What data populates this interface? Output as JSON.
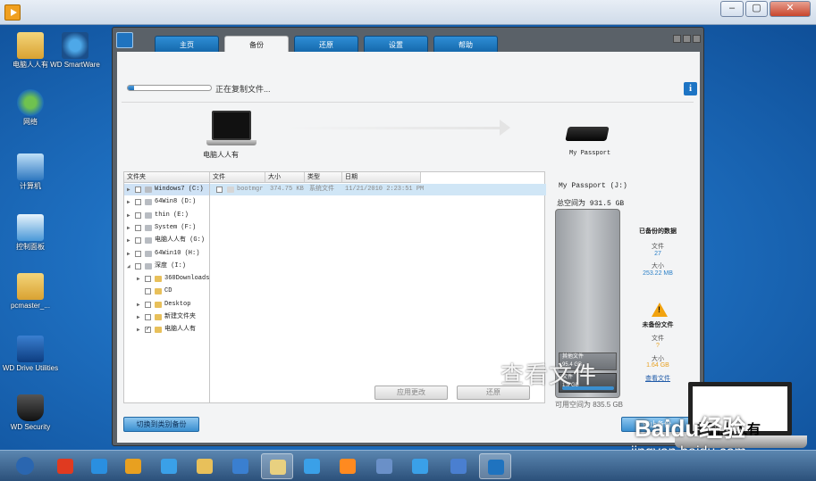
{
  "window": {
    "minimize": "–",
    "maximize": "▢",
    "close": "✕"
  },
  "desktop_icons": [
    {
      "label": "电脑人人有",
      "icon": "folder-icon"
    },
    {
      "label": "WD SmartWare",
      "icon": "wd-smartware-icon"
    },
    {
      "label": "网络",
      "icon": "network-icon"
    },
    {
      "label": "计算机",
      "icon": "computer-icon"
    },
    {
      "label": "控制面板",
      "icon": "control-panel-icon"
    },
    {
      "label": "pcmaster_...",
      "icon": "folder-icon"
    },
    {
      "label": "WD Drive Utilities",
      "icon": "wd-drive-utilities-icon"
    },
    {
      "label": "WD Security",
      "icon": "wd-security-icon"
    }
  ],
  "app": {
    "tabs": [
      "主页",
      "备份",
      "还原",
      "设置",
      "帮助"
    ],
    "active_tab": "备份",
    "copy_progress": 0.08,
    "copy_status": "正在复制文件...",
    "source_label": "电脑人人有",
    "dest_label": "My Passport",
    "folder_header": "文件夹",
    "file_headers": [
      "文件",
      "大小",
      "类型",
      "日期"
    ],
    "folders": [
      {
        "label": "Windows7 (C:)",
        "checked": false,
        "expandable": true,
        "level": 0,
        "selected": true
      },
      {
        "label": "64Win8 (D:)",
        "checked": false,
        "expandable": true,
        "level": 0
      },
      {
        "label": "thin (E:)",
        "checked": false,
        "expandable": true,
        "level": 0
      },
      {
        "label": "System (F:)",
        "checked": false,
        "expandable": true,
        "level": 0
      },
      {
        "label": "电脑人人有 (G:)",
        "checked": false,
        "expandable": true,
        "level": 0
      },
      {
        "label": "64Win10 (H:)",
        "checked": false,
        "expandable": true,
        "level": 0
      },
      {
        "label": "深度 (I:)",
        "checked": false,
        "expandable": true,
        "level": 0,
        "expanded": true
      },
      {
        "label": "360Downloads",
        "checked": false,
        "expandable": true,
        "level": 1
      },
      {
        "label": "CD",
        "checked": false,
        "expandable": false,
        "level": 1
      },
      {
        "label": "Desktop",
        "checked": false,
        "expandable": true,
        "level": 1
      },
      {
        "label": "新建文件夹",
        "checked": false,
        "expandable": true,
        "level": 1
      },
      {
        "label": "电脑人人有",
        "checked": true,
        "expandable": true,
        "level": 1
      }
    ],
    "files": [
      {
        "name": "bootmgr",
        "size": "374.75 KB",
        "type": "系统文件",
        "date": "11/21/2010 2:23:51 PM"
      }
    ],
    "apply_changes": "应用更改",
    "restore_btn": "还原",
    "switch_btn": "切换到类别备份",
    "stop_btn": "停止备份",
    "drive_title": "My Passport (J:)",
    "total_space": "总空间为 931.5 GB",
    "segment_other": {
      "label": "其他文件",
      "size": "95.4 GB"
    },
    "segment_files": {
      "label": "文件",
      "size": "1.9 GB"
    },
    "available": "可用空间为 835.5 GB",
    "backed_up": {
      "title": "已备份的数据",
      "files_label": "文件",
      "files": "27",
      "size_label": "大小",
      "size": "253.22 MB"
    },
    "not_backed": {
      "title": "未备份文件",
      "files_label": "文件",
      "files": "?",
      "size_label": "大小",
      "size": "1.64 GB",
      "view_link": "查看文件"
    }
  },
  "watermark": "查看文件",
  "overlay": {
    "brand": "Baidu经验",
    "url": "jingyan.baidu.com",
    "laptop_text": "电脑人人有"
  },
  "taskbar": [
    "start",
    "360-icon",
    "ie-icon",
    "chrome-icon",
    "browser-icon",
    "folder-icon",
    "control-panel-icon",
    "explorer-icon",
    "flower-icon",
    "media-icon",
    "paint-icon",
    "network-icon",
    "puzzle-icon",
    "wd-icon"
  ]
}
